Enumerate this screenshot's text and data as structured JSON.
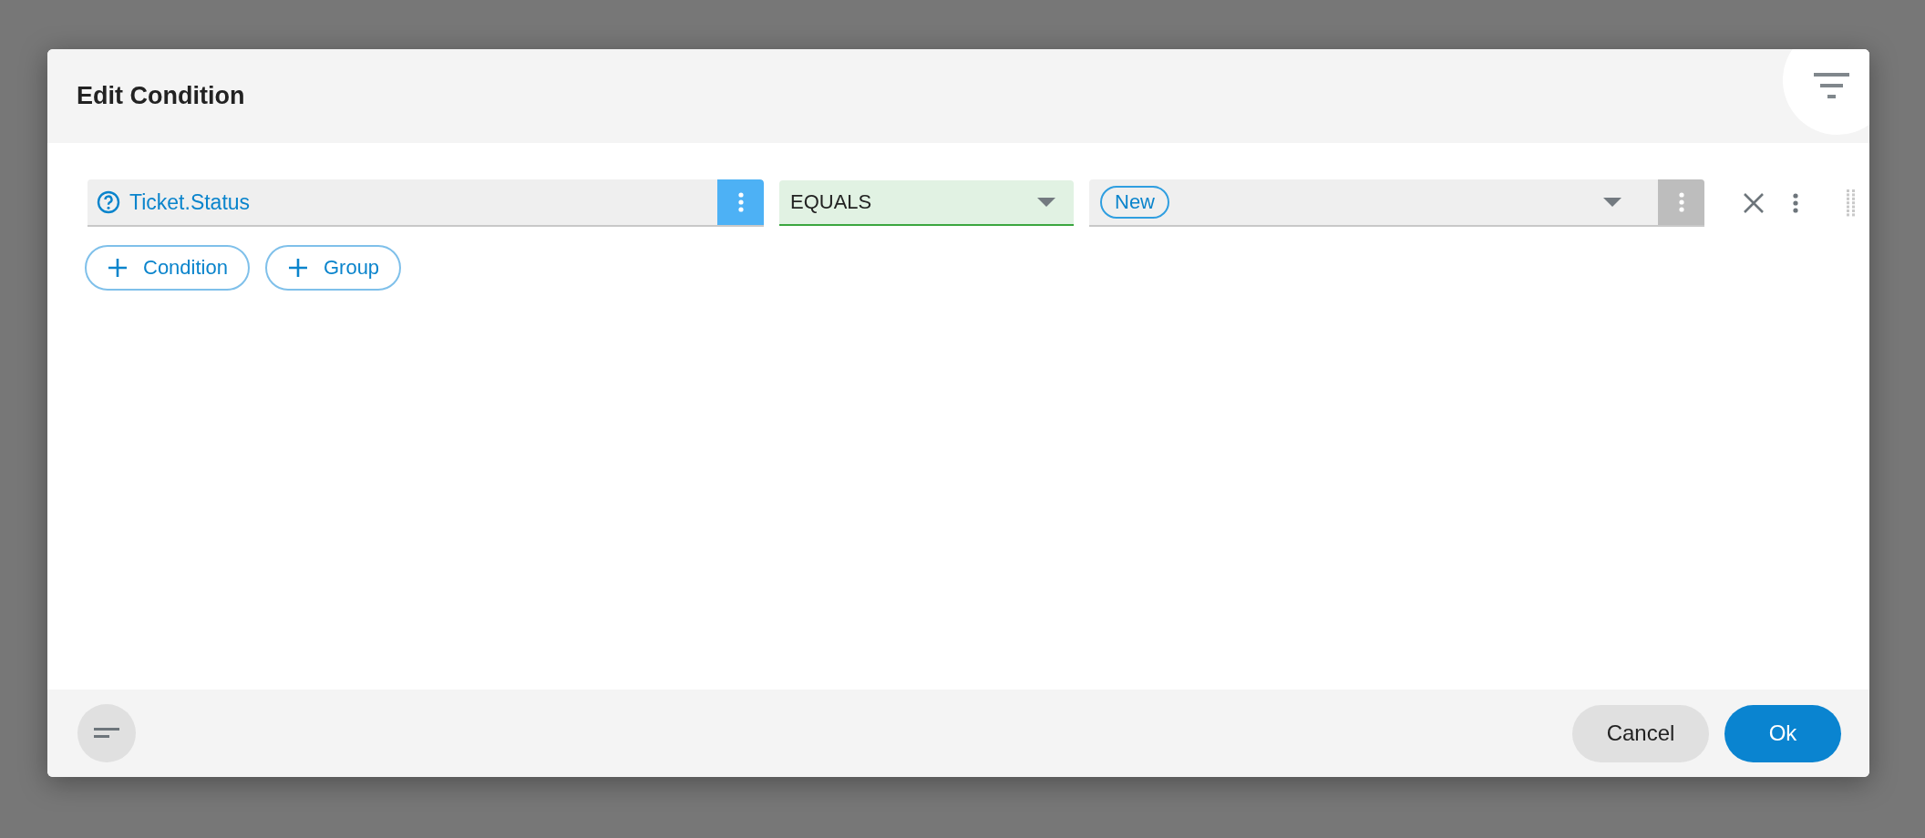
{
  "dialog": {
    "title": "Edit Condition"
  },
  "condition": {
    "field": "Ticket.Status",
    "operator": "EQUALS",
    "values": [
      "New"
    ]
  },
  "add_buttons": [
    "Condition",
    "Group"
  ],
  "buttons": [
    {
      "label": "Cancel",
      "kind": "secondary"
    },
    {
      "label": "Ok",
      "kind": "primary"
    }
  ]
}
